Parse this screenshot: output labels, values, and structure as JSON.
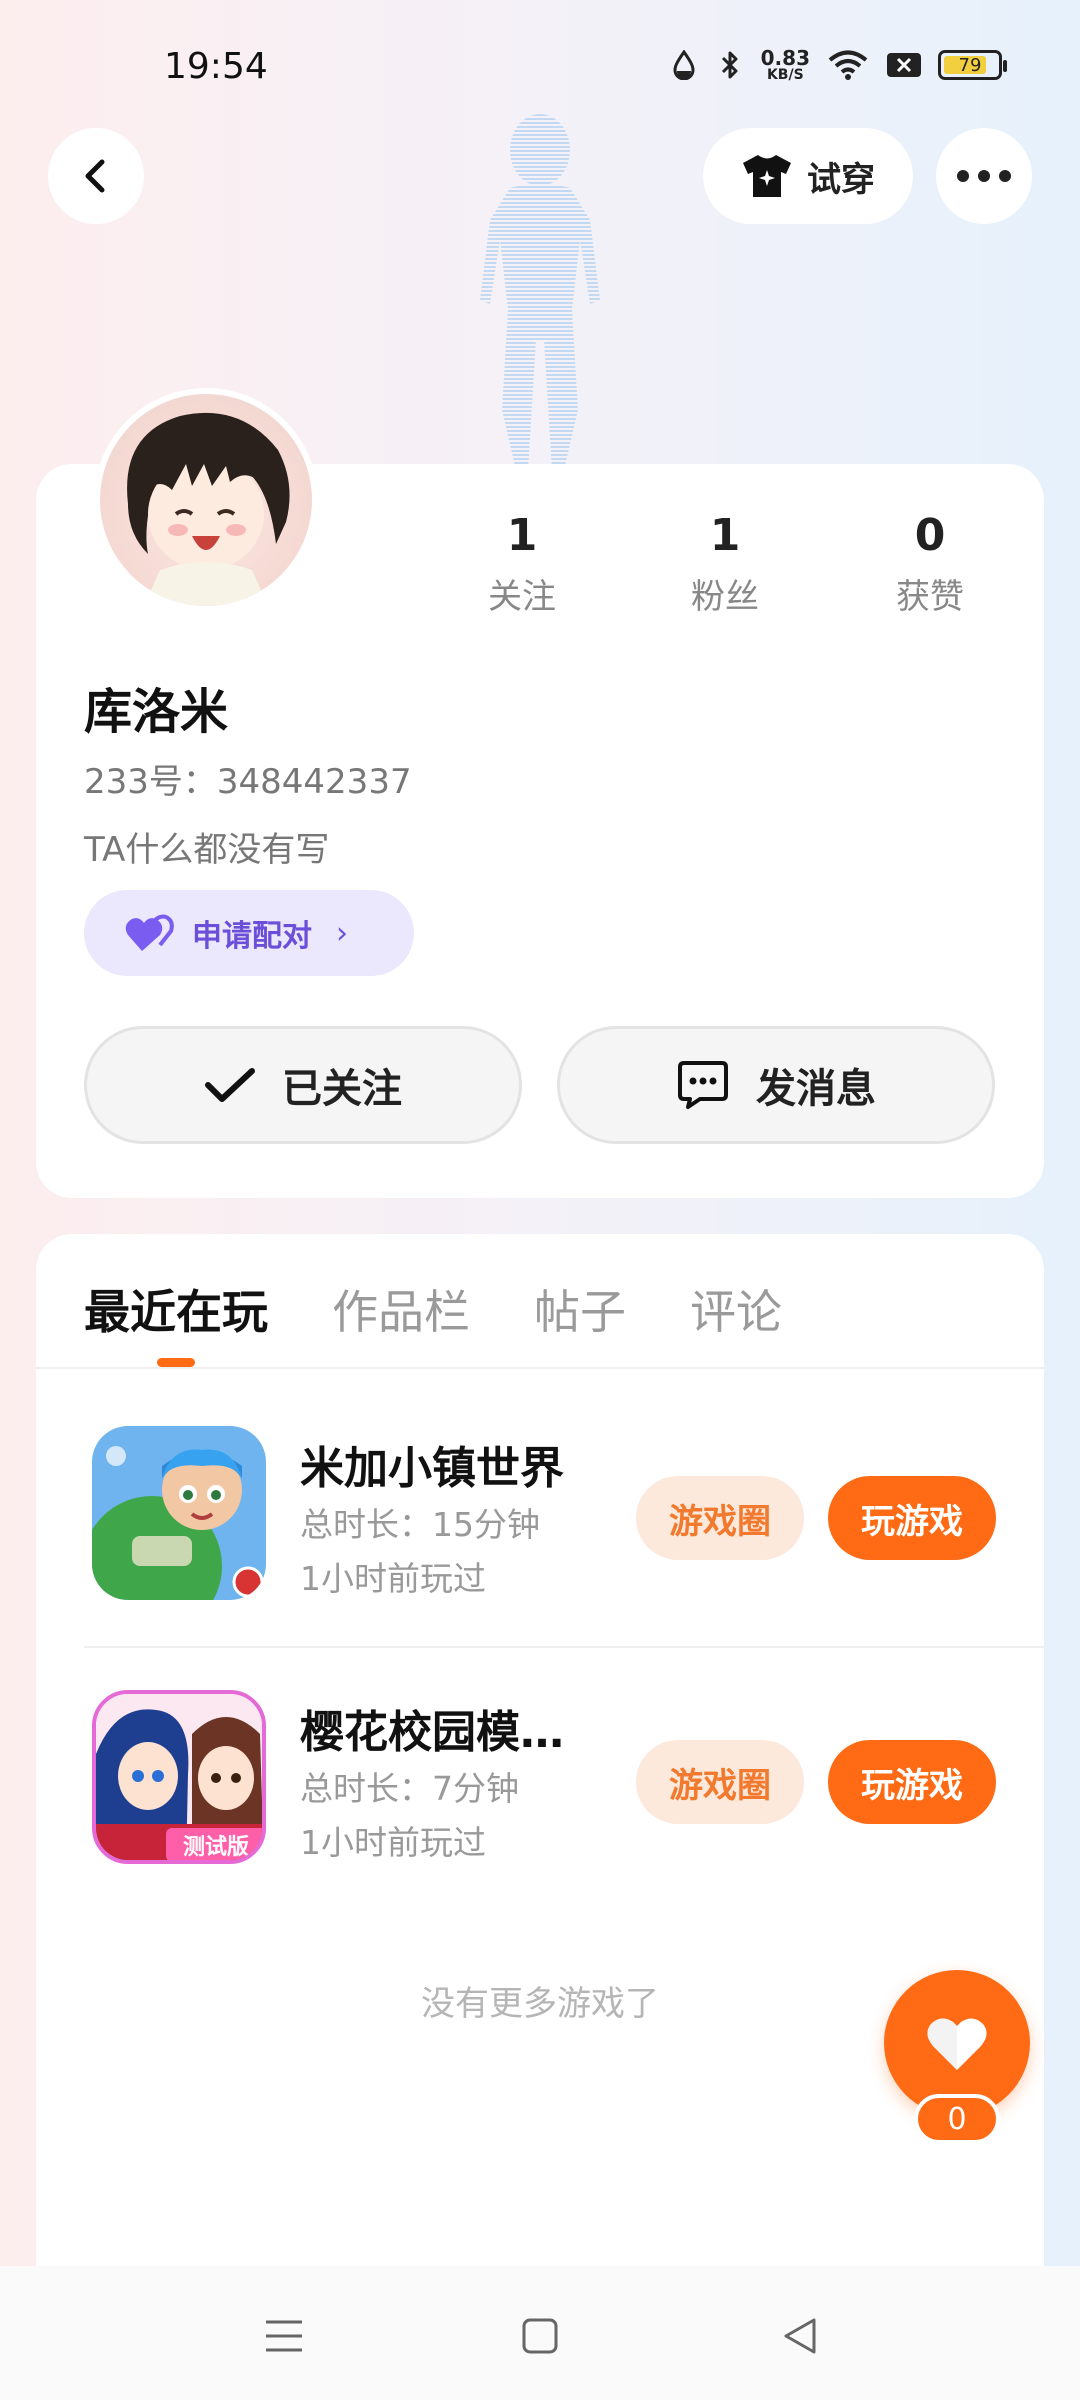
{
  "status_bar": {
    "time": "19:54",
    "net_speed_value": "0.83",
    "net_speed_unit": "KB/S",
    "battery_level": "79",
    "icons": [
      "water-drop-icon",
      "bluetooth-icon",
      "wifi-icon",
      "sim-x-icon",
      "battery-icon"
    ]
  },
  "header": {
    "try_on_label": "试穿",
    "icons": [
      "back-arrow-icon",
      "tshirt-icon",
      "more-dots-icon"
    ]
  },
  "profile": {
    "stats": [
      {
        "value": "1",
        "label": "关注"
      },
      {
        "value": "1",
        "label": "粉丝"
      },
      {
        "value": "0",
        "label": "获赞"
      }
    ],
    "nickname": "库洛米",
    "uid": "233号：348442337",
    "bio": "TA什么都没有写",
    "pair_label": "申请配对",
    "follow_label": "已关注",
    "message_label": "发消息"
  },
  "tabs": [
    "最近在玩",
    "作品栏",
    "帖子",
    "评论"
  ],
  "active_tab": "最近在玩",
  "games": [
    {
      "name": "米加小镇世界",
      "duration": "总时长：15分钟",
      "last_played": "1小时前玩过",
      "circle_label": "游戏圈",
      "play_label": "玩游戏"
    },
    {
      "name": "樱花校园模拟...",
      "duration": "总时长：7分钟",
      "last_played": "1小时前玩过",
      "circle_label": "游戏圈",
      "play_label": "玩游戏",
      "badge": "测试版"
    }
  ],
  "no_more_text": "没有更多游戏了",
  "like_count": "0",
  "colors": {
    "accent_orange": "#ff6a14",
    "pair_purple": "#6b4fd8",
    "pair_bg": "#ebe7fd"
  }
}
